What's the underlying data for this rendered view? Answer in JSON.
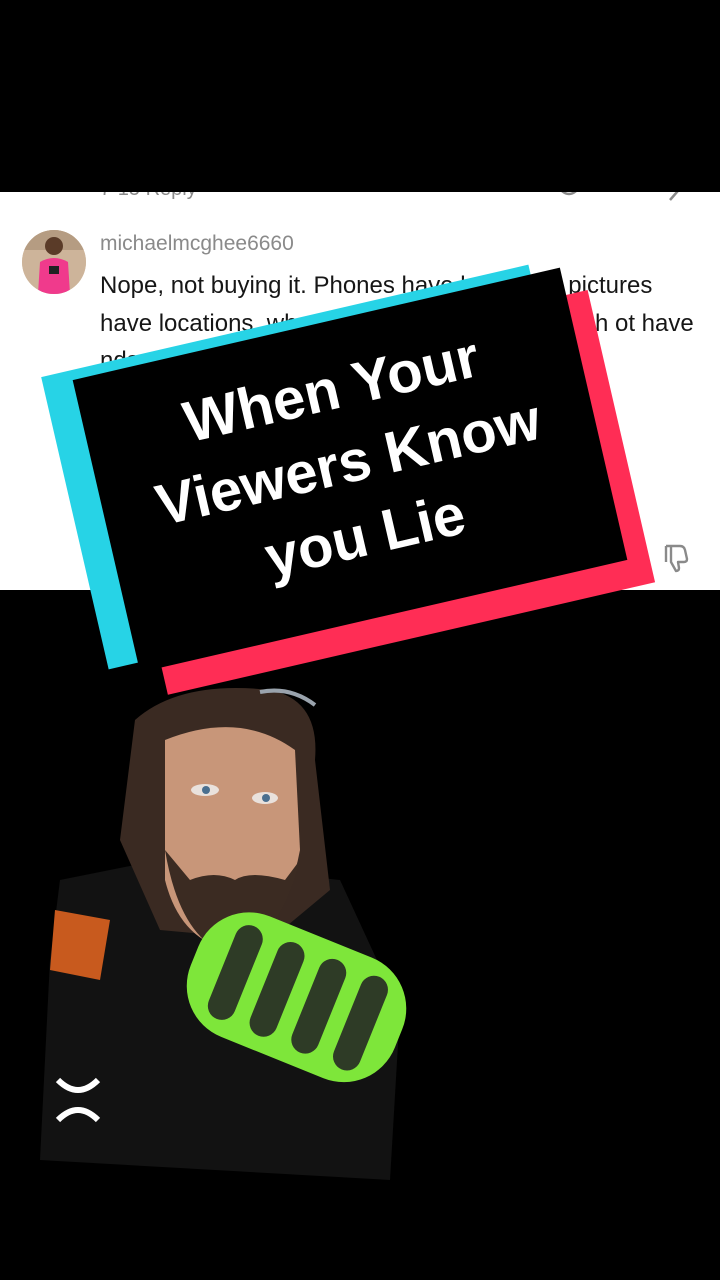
{
  "comment": {
    "prev_row_text": "7-15  Reply",
    "username": "michaelmcghee6660",
    "text": "Nope, not buying it. Phones have locations, pictures have locations, wh       uys did the mortgage                                 aid “oh                                      ot have                                      nds or                                       . There w",
    "date": "7-"
  },
  "banner": {
    "title": "When Your Viewers Know you Lie",
    "colors": {
      "back_left": "#27d3e6",
      "back_right": "#ff2d55",
      "front": "#000000"
    }
  },
  "video": {
    "shirt_logo_icon": "under-armour-logo-icon",
    "mic_color": "#7ee63a"
  }
}
